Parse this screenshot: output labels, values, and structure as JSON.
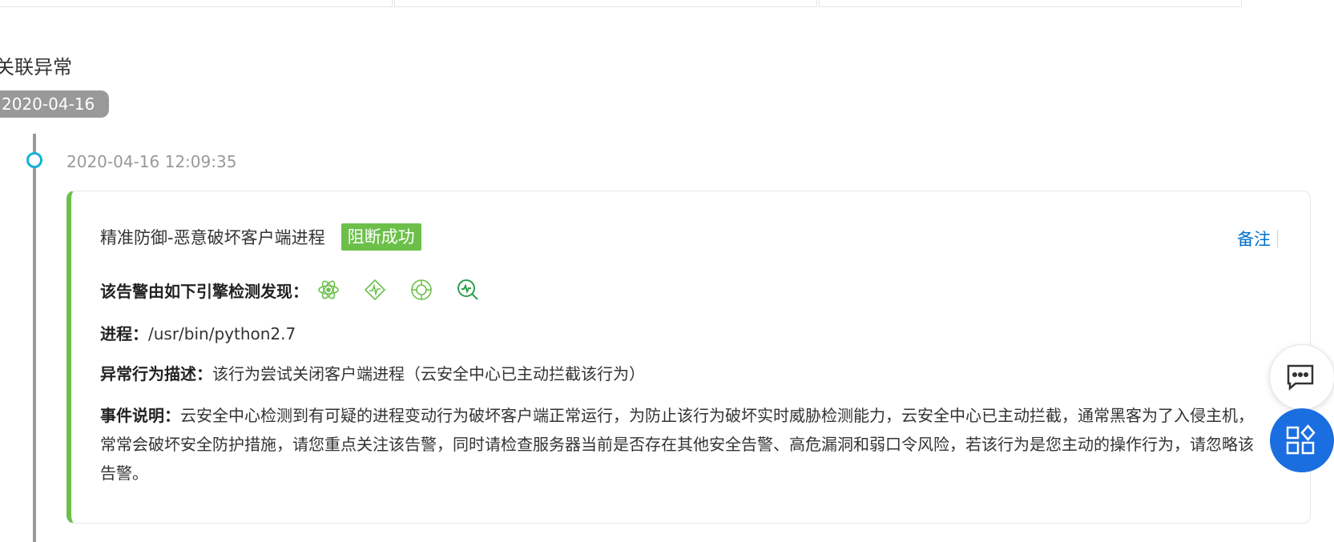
{
  "section": {
    "title": "关联异常"
  },
  "timeline": {
    "date_pill": "2020-04-16",
    "event": {
      "timestamp": "2020-04-16 12:09:35",
      "title": "精准防御-恶意破坏客户端进程",
      "status": "阻断成功",
      "note_link": "备注",
      "engine_label": "该告警由如下引擎检测发现：",
      "engine_icons": [
        "atom-engine-icon",
        "pulse-engine-icon",
        "target-engine-icon",
        "search-pulse-engine-icon"
      ],
      "process_label": "进程：",
      "process_value": "/usr/bin/python2.7",
      "behavior_label": "异常行为描述：",
      "behavior_value": "该行为尝试关闭客户端进程（云安全中心已主动拦截该行为）",
      "event_label": "事件说明：",
      "event_value": "云安全中心检测到有可疑的进程变动行为破坏客户端正常运行，为防止该行为破坏实时威胁检测能力，云安全中心已主动拦截，通常黑客为了入侵主机，常常会破坏安全防护措施，请您重点关注该告警，同时请检查服务器当前是否存在其他安全告警、高危漏洞和弱口令风险，若该行为是您主动的操作行为，请忽略该告警。"
    }
  },
  "colors": {
    "accent_green": "#6cc04a",
    "link_blue": "#0070cc",
    "timeline_dot": "#12b3d3",
    "fab_blue": "#1a6ee0"
  },
  "floating_buttons": [
    "chat-icon",
    "apps-icon"
  ]
}
